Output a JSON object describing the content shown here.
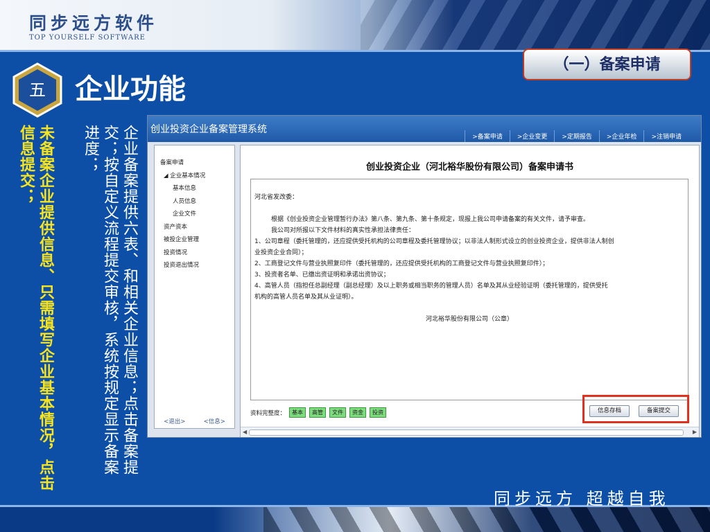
{
  "brand": {
    "name_cn": "同步远方软件",
    "name_en": "TOP YOURSELF SOFTWARE",
    "slogan": "同步远方 超越自我"
  },
  "slide": {
    "badge": "五",
    "title": "企业功能",
    "section_tag": "（一）备案申请",
    "yellow_text": "未备案企业提供信息、只需填写企业基本情况，点击信息提交；",
    "white_text": "企业备案提供六表、和相关企业信息；点击备案提交；按自定义流程提交审核，系统按规定显示备案进度；"
  },
  "app": {
    "title": "创业投资企业备案管理系统",
    "nav": [
      ">备案申请",
      ">企业变更",
      ">定期报告",
      ">企业年检",
      ">注销申请"
    ],
    "sidebar": {
      "items": [
        {
          "label": "备案申请",
          "level": 1
        },
        {
          "label": "◢ 企业基本情况",
          "level": 2
        },
        {
          "label": "基本信息",
          "level": 3
        },
        {
          "label": "人员信息",
          "level": 3
        },
        {
          "label": "企业文件",
          "level": 3
        },
        {
          "label": "资产资本",
          "level": 2
        },
        {
          "label": "被投企业管理",
          "level": 2
        },
        {
          "label": "投资情况",
          "level": 2
        },
        {
          "label": "投资退出情况",
          "level": 2
        }
      ],
      "logout": "<退出>",
      "info": "<信息>"
    },
    "document": {
      "title": "创业投资企业（河北裕华股份有限公司）备案申请书",
      "addressee": "河北省发改委：",
      "para1": "根据《创业投资企业管理暂行办法》第八条、第九条、第十条规定，现报上我公司申请备案的有关文件，请予审查。",
      "para2": "我公司对所报以下文件材料的真实性承担法律责任：",
      "item1a": "1、公司章程（委托管理的，还应提供受托机构的公司章程及委托管理协议；以非法人制形式设立的创业投资企业，提供非法人制创",
      "item1b": "业投资企业合同）；",
      "item2": "2、工商登记文件与营业执照复印件（委托管理的，还应提供受托机构的工商登记文件与营业执照复印件）；",
      "item3": "3、投资者名单、已缴出资证明和承诺出资协议；",
      "item4a": "4、高管人员（指担任总副经理（副总经理）及以上职务或相当职务的管理人员）名单及其从业经验证明（委托管理的，提供受托",
      "item4b": "机构的高管人员名单及其从业证明）。",
      "signature": "河北裕华股份有限公司（公章）"
    },
    "completeness": {
      "label": "资料完整度：",
      "chips": [
        "基本",
        "高管",
        "文件",
        "资金",
        "投资"
      ]
    },
    "buttons": {
      "save": "信息存档",
      "submit": "备案提交"
    },
    "colors": {
      "highlight": "#e0301e",
      "chip_green": "#7ddc7d",
      "header_blue": "#1f5aa8"
    }
  }
}
